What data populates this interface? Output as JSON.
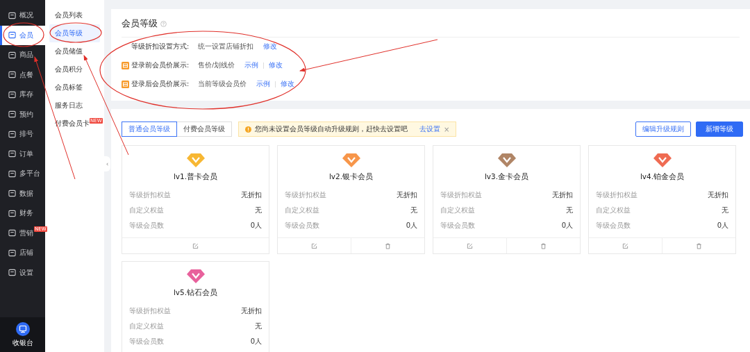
{
  "nav": {
    "items": [
      {
        "label": "概况",
        "selected": false
      },
      {
        "label": "会员",
        "selected": true
      },
      {
        "label": "商品",
        "selected": false
      },
      {
        "label": "点餐",
        "selected": false
      },
      {
        "label": "库存",
        "selected": false
      },
      {
        "label": "预约",
        "selected": false
      },
      {
        "label": "排号",
        "selected": false
      },
      {
        "label": "订单",
        "selected": false
      },
      {
        "label": "多平台",
        "selected": false
      },
      {
        "label": "数据",
        "selected": false
      },
      {
        "label": "财务",
        "selected": false
      },
      {
        "label": "营销",
        "selected": false,
        "badge": "NEW"
      },
      {
        "label": "店铺",
        "selected": false
      },
      {
        "label": "设置",
        "selected": false
      }
    ],
    "cashier": "收银台"
  },
  "submenu": {
    "items": [
      {
        "label": "会员列表",
        "selected": false
      },
      {
        "label": "会员等级",
        "selected": true
      },
      {
        "label": "会员储值",
        "selected": false
      },
      {
        "label": "会员积分",
        "selected": false
      },
      {
        "label": "会员标签",
        "selected": false
      },
      {
        "label": "服务日志",
        "selected": false
      },
      {
        "label": "付费会员卡",
        "selected": false,
        "badge": "NEW"
      }
    ],
    "collapse": "‹"
  },
  "settings": {
    "title": "会员等级",
    "rows": [
      {
        "flag_icon": false,
        "label": "等级折扣设置方式:",
        "value": "统一设置店铺折扣",
        "links": [
          "修改"
        ]
      },
      {
        "flag_icon": true,
        "label": "登录前会员价展示:",
        "value": "售价/划线价",
        "links": [
          "示例",
          "修改"
        ]
      },
      {
        "flag_icon": true,
        "label": "登录后会员价展示:",
        "value": "当前等级会员价",
        "links": [
          "示例",
          "修改"
        ]
      }
    ]
  },
  "tabs": [
    {
      "label": "普通会员等级",
      "selected": true
    },
    {
      "label": "付费会员等级",
      "selected": false
    }
  ],
  "alert": {
    "text": "您尚未设置会员等级自动升级规则，赶快去设置吧",
    "link": "去设置",
    "close": "×"
  },
  "buttons": [
    {
      "label": "编辑升级规则",
      "kind": "outline"
    },
    {
      "label": "新增等级",
      "kind": "primary"
    }
  ],
  "levels": [
    {
      "title": "lv1.普卡会员",
      "color": "#f7b733",
      "rows": [
        {
          "label": "等级折扣权益",
          "value": "无折扣"
        },
        {
          "label": "自定义权益",
          "value": "无"
        },
        {
          "label": "等级会员数",
          "value": "0人"
        }
      ],
      "actions": [
        {
          "kind": "edit"
        }
      ]
    },
    {
      "title": "lv2.银卡会员",
      "color": "#f7964a",
      "rows": [
        {
          "label": "等级折扣权益",
          "value": "无折扣"
        },
        {
          "label": "自定义权益",
          "value": "无"
        },
        {
          "label": "等级会员数",
          "value": "0人"
        }
      ],
      "actions": [
        {
          "kind": "edit"
        },
        {
          "kind": "delete"
        }
      ]
    },
    {
      "title": "lv3.金卡会员",
      "color": "#b08566",
      "rows": [
        {
          "label": "等级折扣权益",
          "value": "无折扣"
        },
        {
          "label": "自定义权益",
          "value": "无"
        },
        {
          "label": "等级会员数",
          "value": "0人"
        }
      ],
      "actions": [
        {
          "kind": "edit"
        },
        {
          "kind": "delete"
        }
      ]
    },
    {
      "title": "lv4.铂金会员",
      "color": "#ef6b52",
      "rows": [
        {
          "label": "等级折扣权益",
          "value": "无折扣"
        },
        {
          "label": "自定义权益",
          "value": "无"
        },
        {
          "label": "等级会员数",
          "value": "0人"
        }
      ],
      "actions": [
        {
          "kind": "edit"
        },
        {
          "kind": "delete"
        }
      ]
    },
    {
      "title": "lv5.钻石会员",
      "color": "#e8619c",
      "rows": [
        {
          "label": "等级折扣权益",
          "value": "无折扣"
        },
        {
          "label": "自定义权益",
          "value": "无"
        },
        {
          "label": "等级会员数",
          "value": "0人"
        }
      ]
    }
  ]
}
